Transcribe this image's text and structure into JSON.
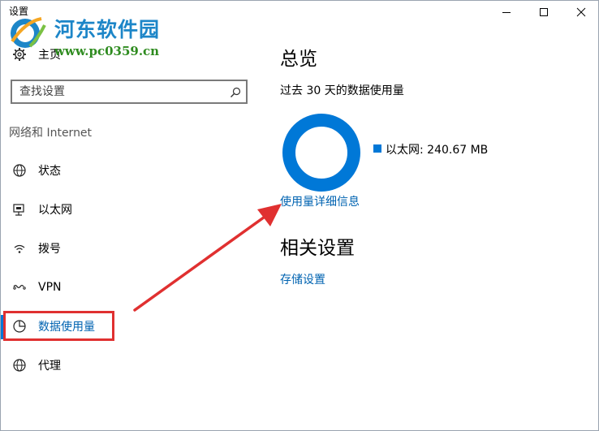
{
  "window": {
    "title": "设置",
    "controls": [
      "minimize",
      "maximize",
      "close"
    ]
  },
  "watermark": {
    "name": "河东软件园",
    "url": "www.pc0359.cn"
  },
  "sidebar": {
    "home_label": "主页",
    "search_placeholder": "查找设置",
    "section_label": "网络和 Internet",
    "items": [
      {
        "label": "状态",
        "icon": "globe-status-icon"
      },
      {
        "label": "以太网",
        "icon": "ethernet-icon"
      },
      {
        "label": "拨号",
        "icon": "dialup-icon"
      },
      {
        "label": "VPN",
        "icon": "vpn-icon"
      },
      {
        "label": "数据使用量",
        "icon": "pie-chart-icon",
        "active": true
      },
      {
        "label": "代理",
        "icon": "globe-icon"
      }
    ]
  },
  "main": {
    "title": "总览",
    "subtitle": "过去 30 天的数据使用量",
    "legend_label": "以太网: 240.67 MB",
    "usage_link": "使用量详细信息",
    "related_title": "相关设置",
    "storage_link": "存储设置"
  },
  "colors": {
    "accent": "#0078d7",
    "link": "#0063b1",
    "annotation": "#e03030"
  }
}
